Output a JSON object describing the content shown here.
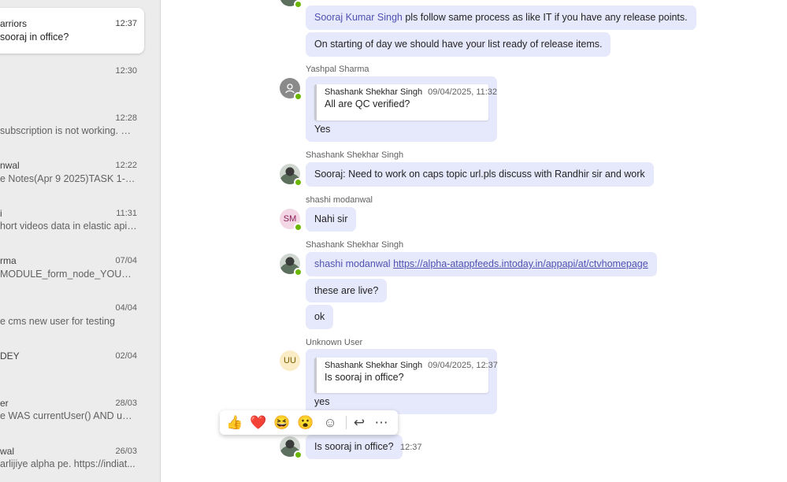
{
  "chat_list": [
    {
      "name": "arriors",
      "time": "12:37",
      "preview": "sooraj in office?",
      "active": true
    },
    {
      "name": "",
      "time": "12:30",
      "preview": ""
    },
    {
      "name": "",
      "time": "12:28",
      "preview": "subscription is not working. Pl..."
    },
    {
      "name": "nwal",
      "time": "12:22",
      "preview": "e Notes(Apr 9 2025)TASK 1- SP..."
    },
    {
      "name": "i",
      "time": "11:31",
      "preview": "hort videos data in elastic api f..."
    },
    {
      "name": "rma",
      "time": "07/04",
      "preview": "MODULE_form_node_YOURC..."
    },
    {
      "name": "",
      "time": "04/04",
      "preview": "e cms new user for testing"
    },
    {
      "name": "DEY",
      "time": "02/04",
      "preview": ""
    },
    {
      "name": "er",
      "time": "28/03",
      "preview": "e WAS currentUser() AND upd..."
    },
    {
      "name": "wal",
      "time": "26/03",
      "preview": "arlijiye alpha pe. https://indiat..."
    }
  ],
  "messages": {
    "m1": {
      "mention": "Sooraj Kumar Singh",
      "text": " pls follow same process as like IT if you have any release points."
    },
    "m2": {
      "text": "On starting of day we should have your list ready of release items."
    },
    "g1": {
      "sender": "Yashpal Sharma",
      "quote_author": "Shashank Shekhar Singh",
      "quote_time": "09/04/2025, 11:32",
      "quote_text": "All are QC verified?",
      "text": "Yes"
    },
    "g2": {
      "sender": "Shashank Shekhar Singh",
      "text": "Sooraj: Need to work on caps topic url.pls discuss with Randhir sir and work"
    },
    "g3": {
      "sender": "shashi modanwal",
      "avatar_initials": "SM",
      "text": "Nahi sir"
    },
    "g4": {
      "sender": "Shashank Shekhar Singh",
      "mention": "shashi modanwal",
      "link": "https://alpha-atappfeeds.intoday.in/appapi/at/ctvhomepage",
      "text2": "these are live?",
      "text3": "ok"
    },
    "g5": {
      "sender": "Unknown User",
      "avatar_initials": "UU",
      "quote_author": "Shashank Shekhar Singh",
      "quote_time": "09/04/2025, 12:37",
      "quote_text": "Is sooraj in office?",
      "text": "yes"
    },
    "g6": {
      "text": "Is sooraj in office?",
      "time": "12:37"
    }
  },
  "reactions": [
    "👍",
    "❤️",
    "😆",
    "😮",
    "☺",
    "↩",
    "⋯"
  ],
  "colors": {
    "bubble": "#e6e8fb",
    "accent": "#4f52b2",
    "presence": "#6bb700",
    "sidebar": "#ececec"
  }
}
